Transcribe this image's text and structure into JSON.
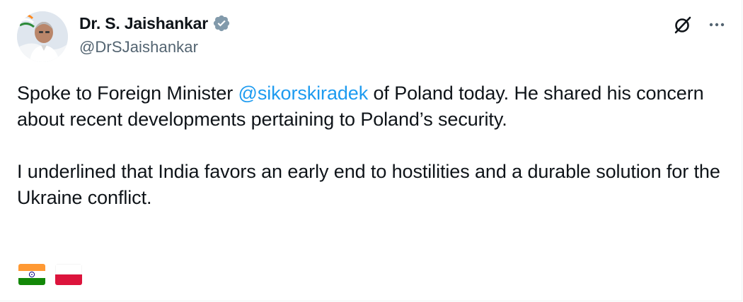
{
  "author": {
    "display_name": "Dr. S. Jaishankar",
    "handle": "@DrSJaishankar",
    "verified": true
  },
  "icons": {
    "verified": "verified-badge-icon",
    "grok": "grok-icon",
    "more": "more-options-icon",
    "flag_india": "india-flag-icon",
    "flag_poland": "poland-flag-icon"
  },
  "tweet": {
    "p1_before": "Spoke to Foreign Minister ",
    "mention": "@sikorskiradek",
    "p1_after": " of Poland today. He shared his concern about recent developments pertaining to Poland’s security.",
    "p2": "I underlined that India favors an early end to hostilities and a durable solution for the Ukraine conflict."
  },
  "colors": {
    "text": "#0f1419",
    "secondary": "#536471",
    "link": "#1d9bf0",
    "verified": "#829aab"
  }
}
